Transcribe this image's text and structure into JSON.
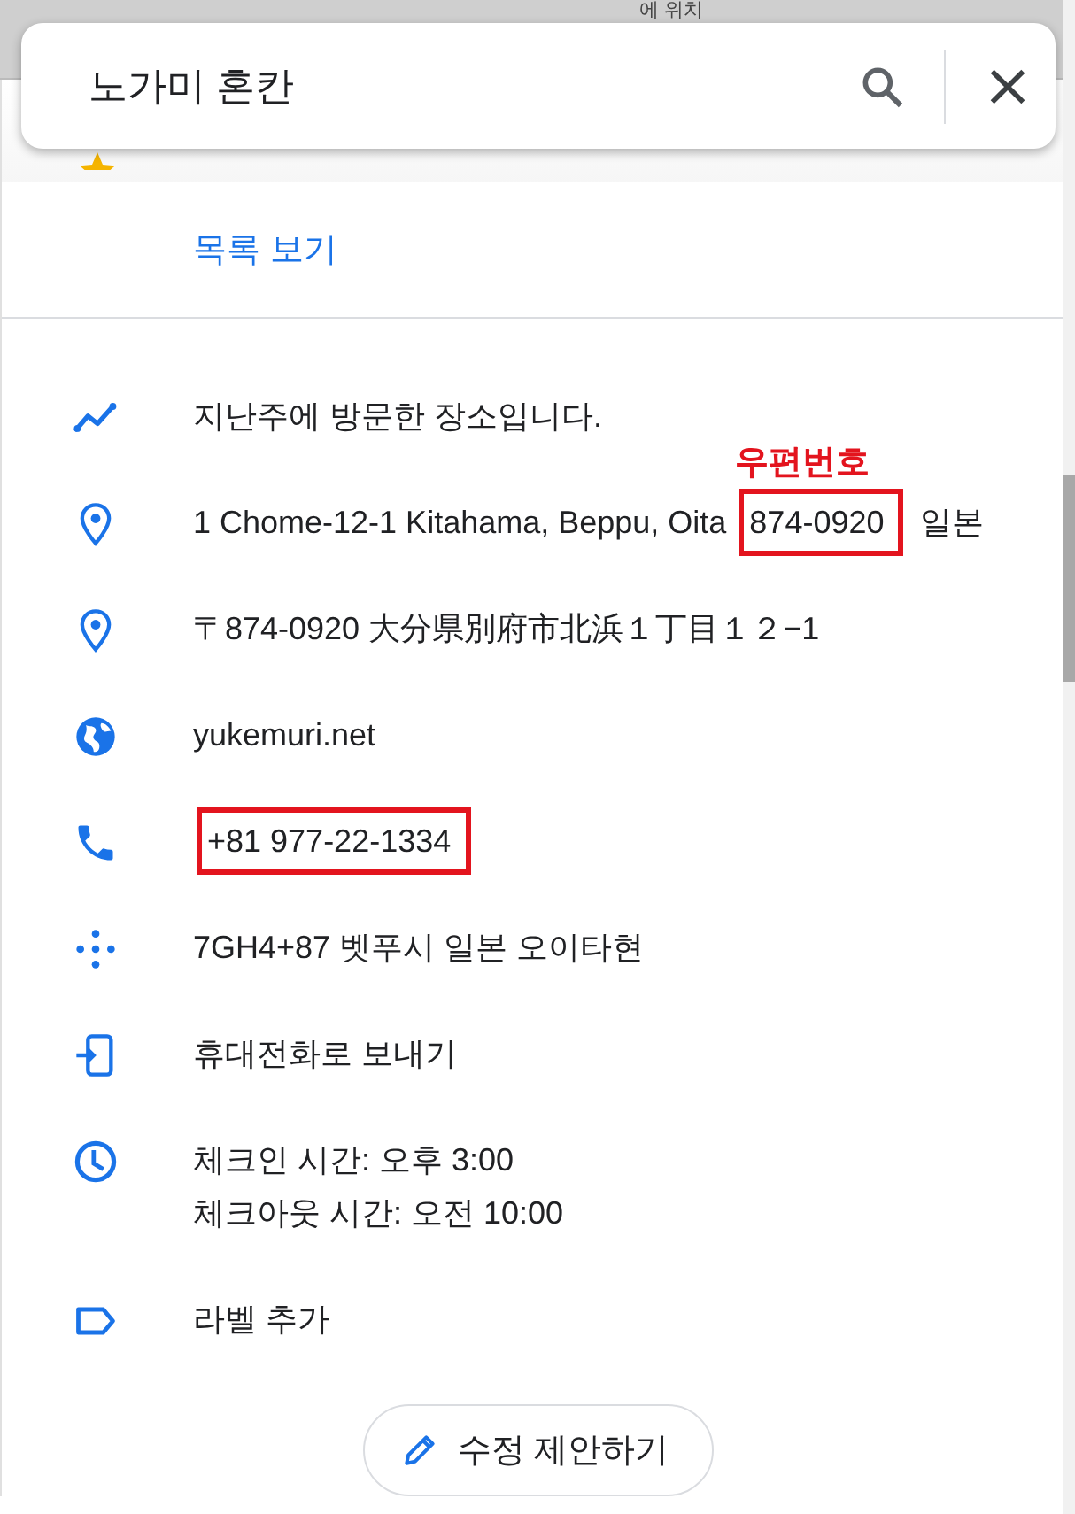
{
  "background_text": "에 위치",
  "search": {
    "value": "노가미 혼칸"
  },
  "list_link": "목록 보기",
  "details": [
    {
      "kind": "timeline",
      "parts": [
        {
          "text": "지난주에 방문한 장소입니다.",
          "boxed": false
        }
      ]
    },
    {
      "kind": "pin",
      "parts": [
        {
          "text": "1 Chome-12-1 Kitahama, Beppu, Oita ",
          "boxed": false
        },
        {
          "text": "874-0920",
          "boxed": true,
          "callout": "우편번호"
        },
        {
          "text": " 일본",
          "boxed": false
        }
      ]
    },
    {
      "kind": "pin",
      "parts": [
        {
          "text": "〒874-0920 大分県別府市北浜１丁目１２−1",
          "boxed": false
        }
      ]
    },
    {
      "kind": "globe",
      "parts": [
        {
          "text": "yukemuri.net",
          "boxed": false
        }
      ]
    },
    {
      "kind": "phone",
      "parts": [
        {
          "text": "+81 977-22-1334",
          "boxed": true
        }
      ]
    },
    {
      "kind": "pluscode",
      "parts": [
        {
          "text": "7GH4+87 벳푸시 일본 오이타현",
          "boxed": false
        }
      ]
    },
    {
      "kind": "send",
      "parts": [
        {
          "text": "휴대전화로 보내기",
          "boxed": false
        }
      ]
    },
    {
      "kind": "clock",
      "lines": [
        "체크인 시간: 오후 3:00",
        "체크아웃 시간: 오전 10:00"
      ]
    },
    {
      "kind": "label",
      "parts": [
        {
          "text": "라벨 추가",
          "boxed": false
        }
      ]
    }
  ],
  "suggest_button": "수정 제안하기"
}
